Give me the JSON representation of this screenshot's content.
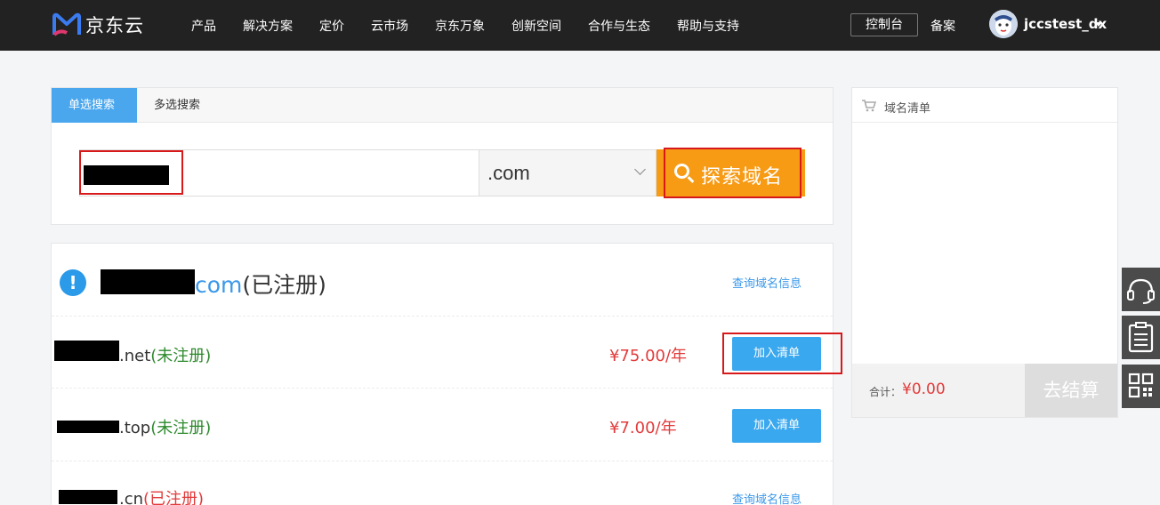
{
  "header": {
    "logo_text": "京东云",
    "nav": [
      "产品",
      "解决方案",
      "定价",
      "云市场",
      "京东万象",
      "创新空间",
      "合作与生态",
      "帮助与支持"
    ],
    "console": "控制台",
    "beian": "备案",
    "username": "jccstest_dx"
  },
  "search": {
    "tabs": [
      "单选搜索",
      "多选搜索"
    ],
    "suffix": ".com",
    "button": "探索域名"
  },
  "results": {
    "main": {
      "tld": "com",
      "status": "(已注册)",
      "link": "查询域名信息"
    },
    "rows": [
      {
        "domain": ".net",
        "status": "(未注册)",
        "price": "¥75.00/年",
        "button": "加入清单"
      },
      {
        "domain": ".top",
        "status": "(未注册)",
        "price": "¥7.00/年",
        "button": "加入清单"
      },
      {
        "domain": ".cn",
        "status": "(已注册)",
        "link": "查询域名信息"
      }
    ]
  },
  "cart": {
    "title": "域名清单",
    "total_label": "合计：",
    "total_value": "¥0.00",
    "checkout": "去结算"
  },
  "icons": [
    "cart-icon",
    "headset-icon",
    "clipboard-icon",
    "qrcode-icon",
    "search-icon",
    "info-icon"
  ],
  "colors": {
    "accent_blue": "#3aa8ee",
    "search_orange": "#f79a14",
    "price_red": "#e23b3b",
    "available_green": "#2d8a2d"
  }
}
